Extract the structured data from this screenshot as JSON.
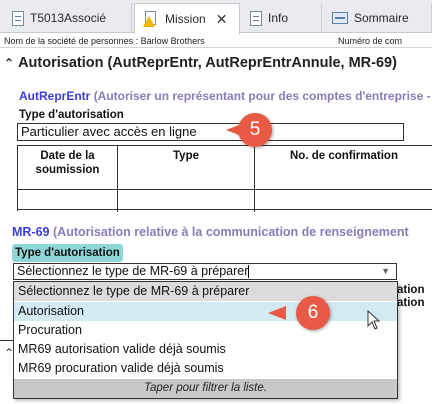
{
  "tabs": [
    {
      "label": "T5013Associé",
      "icon": "document-icon",
      "active": false
    },
    {
      "label": "Mission",
      "icon": "warning-document-icon",
      "active": true,
      "closable": true
    },
    {
      "label": "Info",
      "icon": "document-icon",
      "active": false
    },
    {
      "label": "Sommaire",
      "icon": "summary-icon",
      "active": false
    }
  ],
  "company_line": {
    "left": "Nom de la société de personnes : Barlow Brothers",
    "right": "Numéro de com"
  },
  "section": {
    "title": "Autorisation (AutReprEntr, AutReprEntrAnnule, MR-69)"
  },
  "autreprentr": {
    "code": "AutReprEntr",
    "description": "(Autoriser un représentant pour des comptes d'entreprise -",
    "type_label": "Type d'autorisation",
    "type_value": "Particulier avec accès en ligne",
    "table_headers": [
      "Date de la soumission",
      "Type",
      "No. de confirmation"
    ]
  },
  "mr69": {
    "code": "MR-69",
    "description": "(Autorisation relative à la communication de renseignement",
    "type_label": "Type d'autorisation",
    "select_value": "Sélectionnez le type de MR-69 à préparer",
    "dropdown_options": [
      "Sélectionnez le type de MR-69 à préparer",
      "Autorisation",
      "Procuration",
      "MR69 autorisation valide déjà soumis",
      "MR69 procuration valide déjà soumis"
    ],
    "dropdown_footer": "Taper pour filtrer la liste.",
    "background_right_text_1": "ation",
    "background_right_text_2": "ation"
  },
  "callouts": {
    "first": "5",
    "second": "6"
  },
  "colors": {
    "callout": "#e85a46",
    "code_blue": "#3b3fd8",
    "desc_purple": "#8c7ab9",
    "chip_teal": "#8fd6d8",
    "hover_row": "#d3eaf3"
  }
}
